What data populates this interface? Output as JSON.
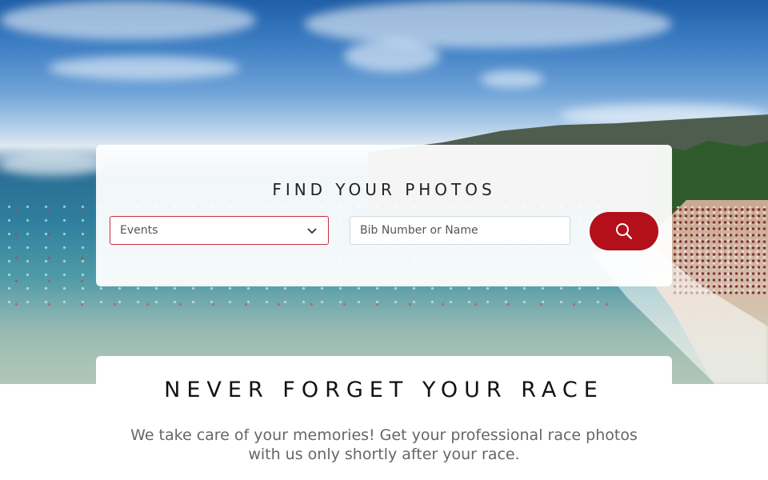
{
  "search": {
    "title": "FIND YOUR PHOTOS",
    "events_label": "Events",
    "bib_placeholder": "Bib Number or Name",
    "button_icon": "search-icon"
  },
  "intro": {
    "headline": "NEVER FORGET YOUR RACE",
    "tagline": "We take care of your memories! Get your professional race photos with us only shortly after your race."
  },
  "colors": {
    "accent": "#b3101b",
    "select_border": "#c9303d"
  }
}
